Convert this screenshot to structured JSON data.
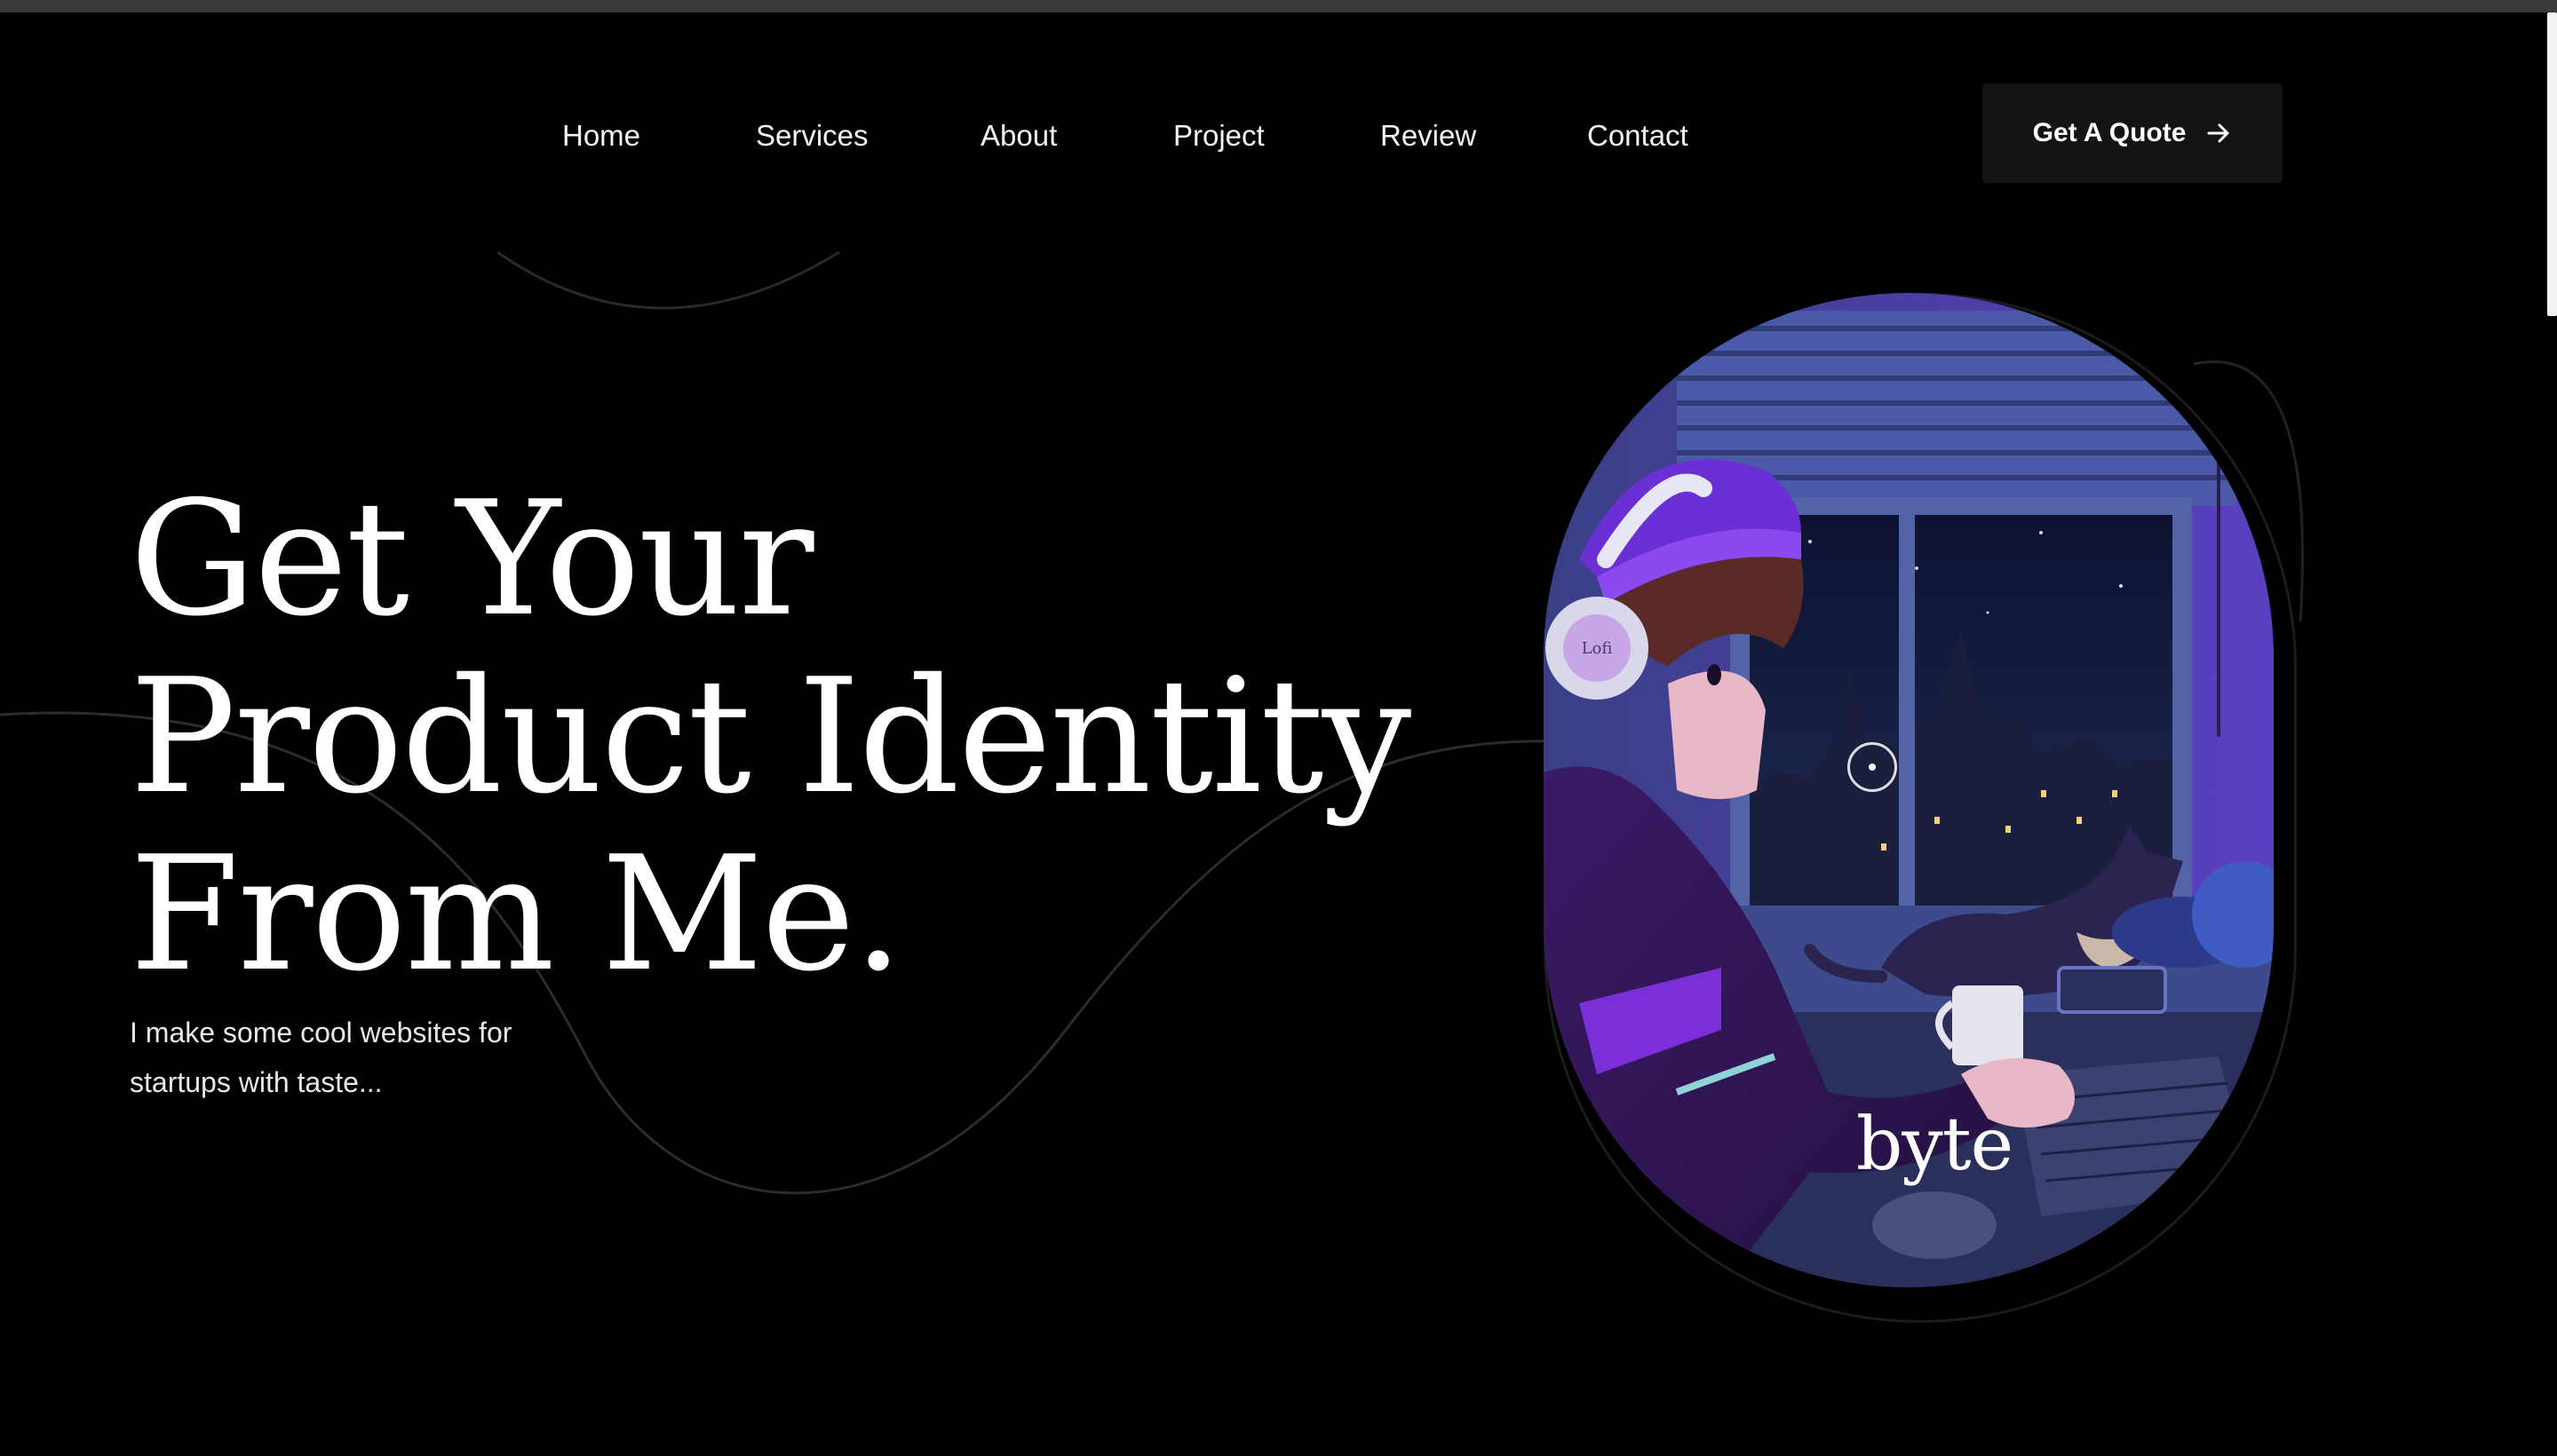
{
  "nav": {
    "items": [
      {
        "label": "Home"
      },
      {
        "label": "Services"
      },
      {
        "label": "About"
      },
      {
        "label": "Project"
      },
      {
        "label": "Review"
      },
      {
        "label": "Contact"
      }
    ],
    "cta_label": "Get A Quote",
    "cta_icon": "arrow-right-icon"
  },
  "hero": {
    "title_lines": [
      "Get Your",
      "Product Identity",
      "From Me."
    ],
    "subtitle_lines": [
      "I make some cool websites for",
      "startups with taste..."
    ]
  },
  "illustration": {
    "logo_text": "byte",
    "headphone_text": "Lofi"
  },
  "colors": {
    "background": "#000000",
    "text": "#ffffff",
    "button_bg": "#141414",
    "accent_purple": "#6a2bd0"
  }
}
